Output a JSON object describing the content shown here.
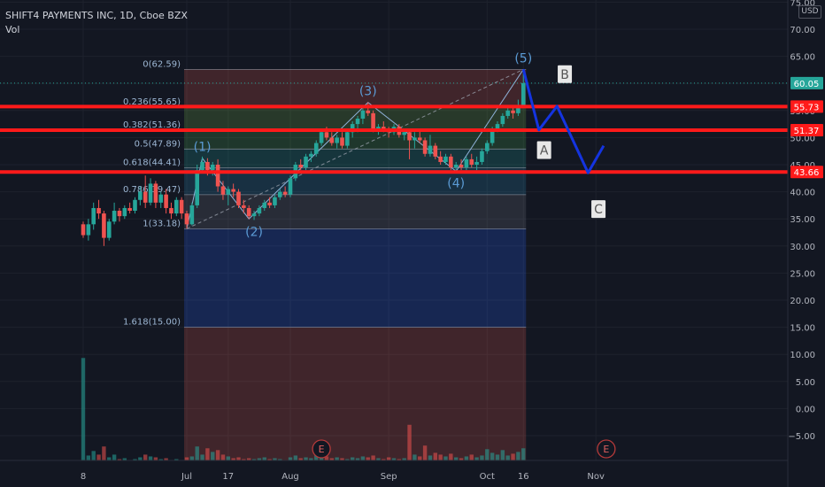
{
  "header": {
    "title": "SHIFT4 PAYMENTS INC, 1D, Cboe BZX",
    "indicator": "Vol",
    "currency": "USD"
  },
  "colors": {
    "background": "#131722",
    "up": "#26a69a",
    "down": "#ef5350",
    "wave_label": "#5b9bd5",
    "projection": "#1434e0",
    "level_line": "#ff1a1a"
  },
  "chart_data": {
    "type": "candlestick",
    "ylim": [
      -10,
      76
    ],
    "yticks": [
      75,
      70,
      65,
      60,
      55,
      50,
      45,
      40,
      35,
      30,
      25,
      20,
      15,
      10,
      5,
      0,
      -5
    ],
    "ytick_labels": [
      "75.00",
      "70.00",
      "65.00",
      "60.00",
      "55.00",
      "50.00",
      "45.00",
      "40.00",
      "35.00",
      "30.00",
      "25.00",
      "20.00",
      "15.00",
      "10.00",
      "5.00",
      "0.00",
      "−5.00"
    ],
    "xticks": [
      "8",
      "Jul",
      "17",
      "Aug",
      "Sep",
      "Oct",
      "16",
      "Nov"
    ],
    "xtick_idx": [
      0,
      20,
      28,
      40,
      59,
      78,
      85,
      99
    ],
    "candles": [
      [
        0,
        34,
        34.5,
        31.5,
        32
      ],
      [
        1,
        32,
        35,
        31,
        34
      ],
      [
        2,
        34,
        38,
        33,
        37
      ],
      [
        3,
        37,
        38.5,
        35,
        36
      ],
      [
        4,
        36,
        36.5,
        30,
        31.5
      ],
      [
        5,
        31.5,
        35,
        31,
        34.5
      ],
      [
        6,
        34.5,
        38,
        34,
        36.5
      ],
      [
        7,
        36.5,
        37,
        34.5,
        35.5
      ],
      [
        8,
        35.5,
        37.5,
        35,
        37
      ],
      [
        9,
        37,
        38,
        36,
        36.5
      ],
      [
        10,
        36.5,
        39,
        36,
        38.5
      ],
      [
        11,
        38.5,
        41,
        37.5,
        40
      ],
      [
        12,
        40,
        43,
        37,
        38
      ],
      [
        13,
        38,
        42.5,
        37.5,
        41.5
      ],
      [
        14,
        41.5,
        42,
        37,
        38
      ],
      [
        15,
        38,
        40,
        37,
        39.5
      ],
      [
        16,
        39.5,
        40.5,
        36,
        37
      ],
      [
        17,
        37,
        38,
        35,
        36
      ],
      [
        18,
        36,
        39,
        35.5,
        38.5
      ],
      [
        19,
        38.5,
        39,
        35,
        36
      ],
      [
        20,
        36,
        36.5,
        33.2,
        34
      ],
      [
        21,
        34,
        38,
        33.8,
        37.5
      ],
      [
        22,
        37.5,
        45,
        37,
        44
      ],
      [
        23,
        44,
        46.5,
        43.5,
        45.5
      ],
      [
        24,
        45.5,
        46.2,
        43,
        44
      ],
      [
        25,
        44,
        45.5,
        43,
        45
      ],
      [
        26,
        45,
        46,
        40,
        41
      ],
      [
        27,
        41,
        42,
        38.5,
        39.5
      ],
      [
        28,
        39.5,
        41,
        37.5,
        40.5
      ],
      [
        29,
        40.5,
        41.5,
        39,
        40
      ],
      [
        30,
        40,
        40.5,
        37,
        37.5
      ],
      [
        31,
        37.5,
        38.5,
        36,
        37
      ],
      [
        32,
        37,
        37.5,
        35,
        35.5
      ],
      [
        33,
        35.5,
        36.5,
        34.8,
        36
      ],
      [
        34,
        36,
        37.5,
        35.5,
        37
      ],
      [
        35,
        37,
        38.5,
        36.5,
        38
      ],
      [
        36,
        38,
        39,
        37,
        37.5
      ],
      [
        37,
        37.5,
        39.5,
        37,
        39
      ],
      [
        38,
        39,
        40.5,
        38.5,
        40
      ],
      [
        39,
        40,
        41,
        39,
        39.5
      ],
      [
        40,
        39.5,
        43,
        39,
        42.5
      ],
      [
        41,
        42.5,
        45.5,
        42,
        45
      ],
      [
        42,
        45,
        46,
        44,
        44.5
      ],
      [
        43,
        44.5,
        47,
        44,
        46.5
      ],
      [
        44,
        46.5,
        47.5,
        45.5,
        47
      ],
      [
        45,
        47,
        49.5,
        46.5,
        49
      ],
      [
        46,
        49,
        51.5,
        48.5,
        51
      ],
      [
        47,
        51,
        52,
        49.5,
        50
      ],
      [
        48,
        50,
        51,
        48.5,
        49
      ],
      [
        49,
        49,
        50.5,
        48,
        50
      ],
      [
        50,
        50,
        51,
        48,
        48.5
      ],
      [
        51,
        48.5,
        51.5,
        48,
        51
      ],
      [
        52,
        51,
        53,
        50,
        52.5
      ],
      [
        53,
        52.5,
        54,
        51,
        53.5
      ],
      [
        54,
        53.5,
        56,
        52.5,
        55
      ],
      [
        55,
        55,
        56.5,
        54,
        54.5
      ],
      [
        56,
        54.5,
        55,
        51,
        51.5
      ],
      [
        57,
        51.5,
        52.5,
        50.5,
        52
      ],
      [
        58,
        52,
        53,
        51,
        51.5
      ],
      [
        59,
        51.5,
        52,
        50,
        51
      ],
      [
        60,
        51,
        52.5,
        50.5,
        52
      ],
      [
        61,
        52,
        52.5,
        50,
        50.5
      ],
      [
        62,
        50.5,
        51.5,
        49.5,
        51
      ],
      [
        63,
        51,
        51.2,
        46,
        49.5
      ],
      [
        64,
        49.5,
        51,
        48,
        50
      ],
      [
        65,
        50,
        51.5,
        49,
        49.5
      ],
      [
        66,
        49.5,
        50,
        46.5,
        47
      ],
      [
        67,
        47,
        50.5,
        46.5,
        48.5
      ],
      [
        68,
        48.5,
        49,
        46,
        46.5
      ],
      [
        69,
        46.5,
        47.5,
        45,
        45.5
      ],
      [
        70,
        45.5,
        47,
        45,
        46.5
      ],
      [
        71,
        46.5,
        47,
        44,
        44.5
      ],
      [
        72,
        44.5,
        45.5,
        43.8,
        45
      ],
      [
        73,
        45,
        46,
        44,
        44.5
      ],
      [
        74,
        44.5,
        46.5,
        44,
        46
      ],
      [
        75,
        46,
        47,
        44.5,
        45
      ],
      [
        76,
        45,
        46.5,
        44,
        45.5
      ],
      [
        77,
        45.5,
        48,
        45,
        47.5
      ],
      [
        78,
        47.5,
        49.5,
        47,
        49
      ],
      [
        79,
        49,
        52,
        48.5,
        51.5
      ],
      [
        80,
        51.5,
        53,
        51,
        52.5
      ],
      [
        81,
        52.5,
        54.5,
        52,
        54
      ],
      [
        82,
        54,
        55.5,
        53.5,
        55
      ],
      [
        83,
        55,
        56,
        53.5,
        54.5
      ],
      [
        84,
        54.5,
        57,
        54,
        56
      ],
      [
        85,
        56,
        62.59,
        56,
        60.05
      ]
    ],
    "volumes": [
      [
        0,
        11.6,
        1
      ],
      [
        1,
        0.8,
        1
      ],
      [
        2,
        1.3,
        1
      ],
      [
        3,
        0.9,
        0
      ],
      [
        4,
        1.8,
        0
      ],
      [
        5,
        0.6,
        1
      ],
      [
        6,
        0.9,
        1
      ],
      [
        7,
        0.4,
        0
      ],
      [
        8,
        0.5,
        1
      ],
      [
        9,
        0.3,
        0
      ],
      [
        10,
        0.4,
        1
      ],
      [
        11,
        0.6,
        1
      ],
      [
        12,
        0.9,
        0
      ],
      [
        13,
        0.7,
        1
      ],
      [
        14,
        0.6,
        0
      ],
      [
        15,
        0.4,
        1
      ],
      [
        16,
        0.5,
        0
      ],
      [
        17,
        0.3,
        0
      ],
      [
        18,
        0.4,
        1
      ],
      [
        19,
        0.3,
        0
      ],
      [
        20,
        0.6,
        0
      ],
      [
        21,
        0.7,
        1
      ],
      [
        22,
        1.8,
        1
      ],
      [
        23,
        0.9,
        1
      ],
      [
        24,
        1.6,
        0
      ],
      [
        25,
        1.2,
        1
      ],
      [
        26,
        1.4,
        0
      ],
      [
        27,
        0.9,
        0
      ],
      [
        28,
        0.7,
        1
      ],
      [
        29,
        0.5,
        0
      ],
      [
        30,
        0.6,
        0
      ],
      [
        31,
        0.4,
        0
      ],
      [
        32,
        0.5,
        0
      ],
      [
        33,
        0.4,
        1
      ],
      [
        34,
        0.5,
        1
      ],
      [
        35,
        0.6,
        1
      ],
      [
        36,
        0.4,
        0
      ],
      [
        37,
        0.5,
        1
      ],
      [
        38,
        0.4,
        1
      ],
      [
        39,
        0.3,
        0
      ],
      [
        40,
        0.6,
        1
      ],
      [
        41,
        0.8,
        1
      ],
      [
        42,
        0.5,
        0
      ],
      [
        43,
        0.6,
        1
      ],
      [
        44,
        0.5,
        1
      ],
      [
        45,
        0.9,
        1
      ],
      [
        46,
        1.2,
        1
      ],
      [
        47,
        0.7,
        0
      ],
      [
        48,
        0.5,
        0
      ],
      [
        49,
        0.6,
        1
      ],
      [
        50,
        0.5,
        0
      ],
      [
        51,
        0.4,
        1
      ],
      [
        52,
        0.6,
        1
      ],
      [
        53,
        0.5,
        1
      ],
      [
        54,
        0.7,
        1
      ],
      [
        55,
        0.6,
        0
      ],
      [
        56,
        0.8,
        0
      ],
      [
        57,
        0.5,
        1
      ],
      [
        58,
        0.4,
        0
      ],
      [
        59,
        0.6,
        0
      ],
      [
        60,
        0.5,
        1
      ],
      [
        61,
        0.4,
        0
      ],
      [
        62,
        0.5,
        1
      ],
      [
        63,
        4.2,
        0
      ],
      [
        64,
        0.9,
        1
      ],
      [
        65,
        0.7,
        0
      ],
      [
        66,
        1.9,
        0
      ],
      [
        67,
        0.8,
        1
      ],
      [
        68,
        1.1,
        0
      ],
      [
        69,
        0.9,
        0
      ],
      [
        70,
        0.7,
        1
      ],
      [
        71,
        1.0,
        0
      ],
      [
        72,
        0.6,
        1
      ],
      [
        73,
        0.5,
        0
      ],
      [
        74,
        0.7,
        1
      ],
      [
        75,
        0.9,
        0
      ],
      [
        76,
        0.6,
        1
      ],
      [
        77,
        0.8,
        1
      ],
      [
        78,
        1.5,
        1
      ],
      [
        79,
        1.1,
        1
      ],
      [
        80,
        0.9,
        1
      ],
      [
        81,
        1.4,
        1
      ],
      [
        82,
        0.8,
        1
      ],
      [
        83,
        1.0,
        0
      ],
      [
        84,
        1.2,
        1
      ],
      [
        85,
        1.6,
        1
      ]
    ],
    "fib": [
      {
        "label": "0(62.59)",
        "price": 62.59
      },
      {
        "label": "0.236(55.65)",
        "price": 55.65
      },
      {
        "label": "0.382(51.36)",
        "price": 51.36
      },
      {
        "label": "0.5(47.89)",
        "price": 47.89
      },
      {
        "label": "0.618(44.41)",
        "price": 44.41
      },
      {
        "label": "0.786(39.47)",
        "price": 39.47
      },
      {
        "label": "1(33.18)",
        "price": 33.18
      },
      {
        "label": "1.618(15.00)",
        "price": 15.0
      }
    ],
    "fib_range": {
      "start": 20,
      "end": 85
    },
    "fib_zones": [
      {
        "from": 62.59,
        "to": 55.65,
        "color": "#e35a4f"
      },
      {
        "from": 55.65,
        "to": 51.36,
        "color": "#78b84a"
      },
      {
        "from": 51.36,
        "to": 47.89,
        "color": "#4caf50"
      },
      {
        "from": 47.89,
        "to": 44.41,
        "color": "#26a69a"
      },
      {
        "from": 44.41,
        "to": 39.47,
        "color": "#2d8fb5"
      },
      {
        "from": 39.47,
        "to": 33.18,
        "color": "#787b86"
      },
      {
        "from": 33.18,
        "to": 15.0,
        "color": "#2962ff"
      },
      {
        "from": 15.0,
        "to": -10,
        "color": "#e35a4f"
      }
    ],
    "levels": [
      {
        "price": 55.73,
        "label": "55.73"
      },
      {
        "price": 51.37,
        "label": "51.37"
      },
      {
        "price": 43.66,
        "label": "43.66"
      }
    ],
    "last_price": {
      "price": 60.05,
      "label": "60.05"
    },
    "waves": [
      {
        "label": "(1)",
        "x": 23,
        "y": 46.2,
        "pos": "above"
      },
      {
        "label": "(2)",
        "x": 33,
        "y": 34.8,
        "pos": "below"
      },
      {
        "label": "(3)",
        "x": 55,
        "y": 56.5,
        "pos": "above"
      },
      {
        "label": "(4)",
        "x": 72,
        "y": 43.8,
        "pos": "below"
      },
      {
        "label": "(5)",
        "x": 85,
        "y": 62.6,
        "pos": "above"
      }
    ],
    "wave_path": [
      [
        20,
        33.18
      ],
      [
        23,
        46.2
      ],
      [
        32,
        35
      ],
      [
        55,
        56.5
      ],
      [
        72,
        43.8
      ],
      [
        85,
        62.6
      ]
    ],
    "projection": [
      [
        85,
        62.6
      ],
      [
        88,
        51.4
      ],
      [
        91.5,
        55.8
      ],
      [
        97.5,
        43.5
      ],
      [
        100.5,
        48.5
      ]
    ],
    "abc": [
      {
        "label": "A",
        "x": 89,
        "y": 47.7
      },
      {
        "label": "B",
        "x": 93,
        "y": 61.7
      },
      {
        "label": "C",
        "x": 99.5,
        "y": 36.8
      }
    ],
    "earnings": [
      {
        "label": "E",
        "x": 46
      },
      {
        "label": "E",
        "x": 101
      }
    ]
  }
}
